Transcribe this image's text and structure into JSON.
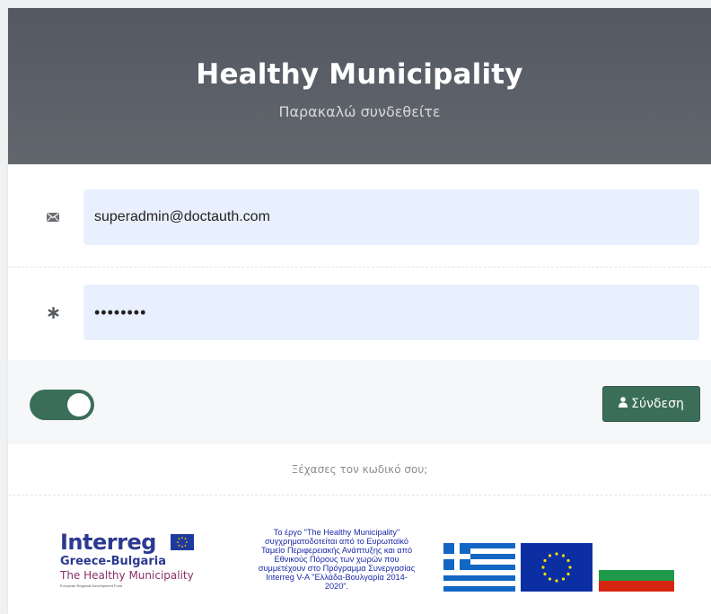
{
  "header": {
    "title": "Healthy Municipality",
    "subtitle": "Παρακαλώ συνδεθείτε"
  },
  "form": {
    "email_icon": "envelope-icon",
    "email_value": "superadmin@doctauth.com",
    "password_icon": "asterisk-icon",
    "password_value": "••••••••",
    "remember_toggle_on": true,
    "login_label": "Σύνδεση",
    "login_icon": "user-icon"
  },
  "forgot_password": "Ξέχασες τον κωδικό σου;",
  "footer": {
    "logo": {
      "word": "Interreg",
      "region": "Greece-Bulgaria",
      "project": "The Healthy Municipality",
      "fund": "European Regional Development Fund"
    },
    "funding_lines": [
      "Το έργο \"The Healthy Municipality\"",
      "συγχρηματοδοτείται από το Ευρωπαϊκό",
      "Ταμείο Περιφερειακής Ανάπτυξης και από",
      "Εθνικούς Πόρους των χωρών που",
      "συμμετέχουν στο Πρόγραμμα Συνεργασίας",
      "Interreg V-A \"Ελλάδα-Βουλγαρία 2014-",
      "2020\"."
    ]
  },
  "colors": {
    "accent": "#3a6e58",
    "header_bg": "#585c64",
    "input_bg": "#e8f0fe",
    "funding_text": "#1c2aa8"
  }
}
